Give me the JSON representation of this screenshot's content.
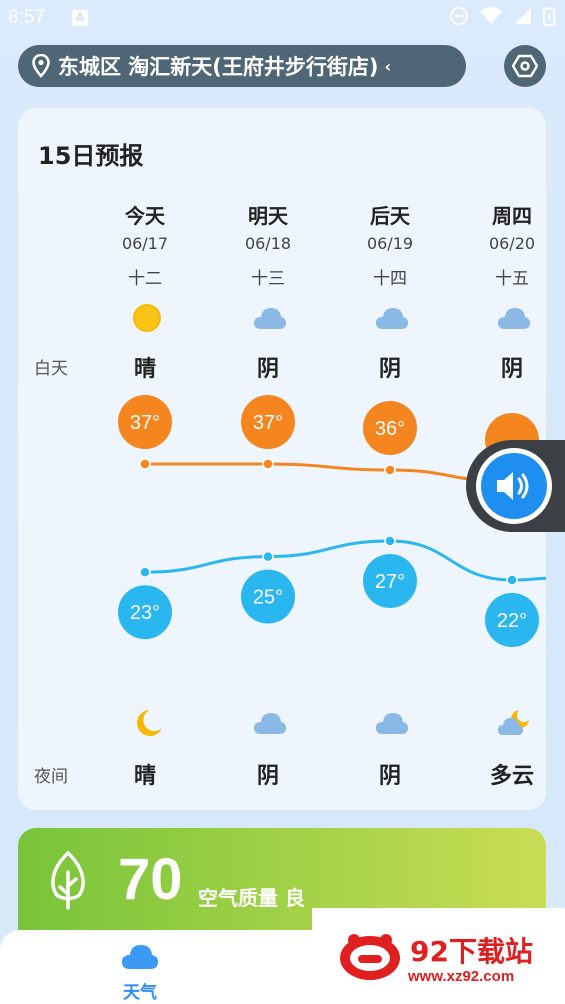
{
  "status_bar": {
    "time": "8:57",
    "a_badge": "A"
  },
  "location": {
    "text": "东城区 淘汇新天(王府井步行街店)",
    "overflow_glyph": "‹"
  },
  "forecast": {
    "title": "15日预报",
    "day_label": "白天",
    "night_label": "夜间",
    "days": [
      {
        "name": "今天",
        "date": "06/17",
        "lunar": "十二",
        "day_icon": "sun-icon",
        "day_cond": "晴",
        "high": "37°",
        "low": "23°",
        "night_icon": "moon-icon",
        "night_cond": "晴"
      },
      {
        "name": "明天",
        "date": "06/18",
        "lunar": "十三",
        "day_icon": "cloud-icon",
        "day_cond": "阴",
        "high": "37°",
        "low": "25°",
        "night_icon": "cloud-icon",
        "night_cond": "阴"
      },
      {
        "name": "后天",
        "date": "06/19",
        "lunar": "十四",
        "day_icon": "cloud-icon",
        "day_cond": "阴",
        "high": "36°",
        "low": "27°",
        "night_icon": "cloud-icon",
        "night_cond": "阴"
      },
      {
        "name": "周四",
        "date": "06/20",
        "lunar": "十五",
        "day_icon": "cloud-icon",
        "day_cond": "阴",
        "high": "",
        "low": "22°",
        "night_icon": "partly-cloudy-night-icon",
        "night_cond": "多云"
      }
    ],
    "high_values": [
      37,
      37,
      36,
      34
    ],
    "low_values": [
      23,
      25,
      27,
      22
    ]
  },
  "aqi": {
    "value": "70",
    "label": "空气质量 良"
  },
  "bottom_nav": {
    "weather_label": "天气"
  },
  "watermark": {
    "title": "92下载站",
    "url": "www.xz92.com"
  },
  "colors": {
    "high": "#f5851f",
    "low": "#2ab7f0",
    "accent": "#1e8ef0"
  }
}
